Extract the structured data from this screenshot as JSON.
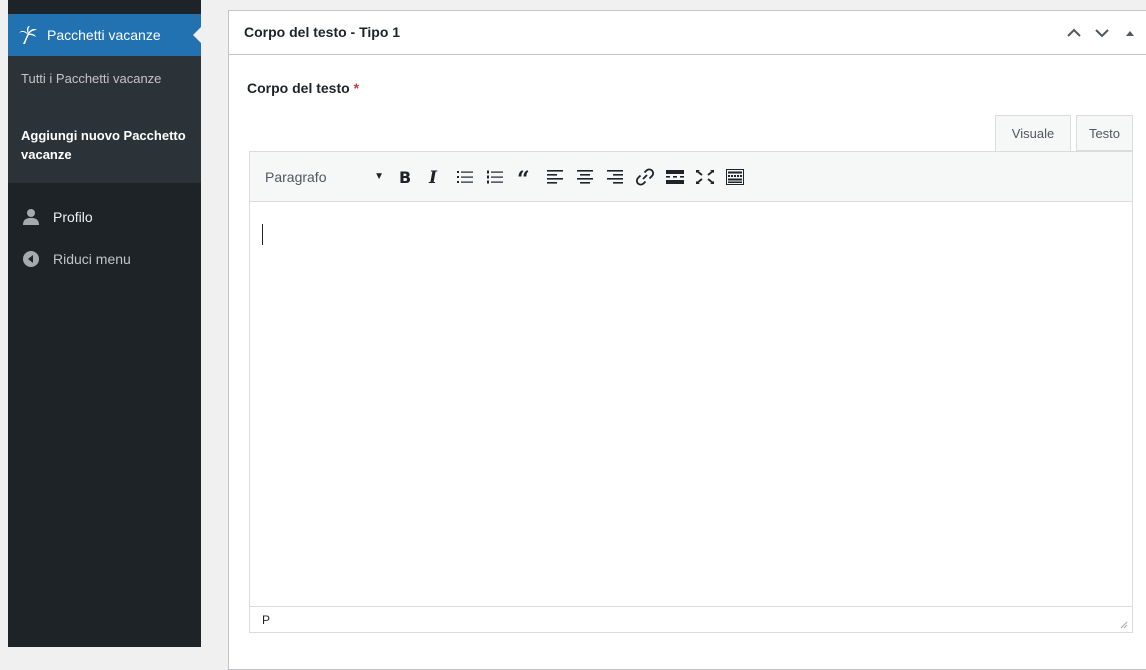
{
  "sidebar": {
    "active_item": {
      "label": "Pacchetti vacanze",
      "icon": "palm-tree-icon"
    },
    "submenu": [
      {
        "label": "Tutti i Pacchetti vacanze",
        "current": false
      },
      {
        "label": "Aggiungi nuovo Pacchetto vacanze",
        "current": true
      }
    ],
    "items": [
      {
        "label": "Profilo",
        "icon": "user-icon"
      },
      {
        "label": "Riduci menu",
        "icon": "collapse-arrow-icon"
      }
    ],
    "colors": {
      "background": "#1d2327",
      "submenu_bg": "#2c3338",
      "accent": "#2271b1"
    }
  },
  "metabox": {
    "title": "Corpo del testo - Tipo 1",
    "controls": [
      "chevron-up-icon",
      "chevron-down-icon",
      "triangle-up-icon"
    ]
  },
  "field": {
    "label": "Corpo del testo",
    "required_mark": "*"
  },
  "editor": {
    "tabs": [
      {
        "label": "Visuale",
        "active": true
      },
      {
        "label": "Testo",
        "active": false
      }
    ],
    "format_select": {
      "value": "Paragrafo"
    },
    "toolbar_buttons": [
      "bold",
      "italic",
      "bulleted-list",
      "numbered-list",
      "blockquote",
      "align-left",
      "align-center",
      "align-right",
      "insert-link",
      "read-more",
      "fullscreen",
      "toolbar-toggle"
    ],
    "status_path": "P"
  }
}
